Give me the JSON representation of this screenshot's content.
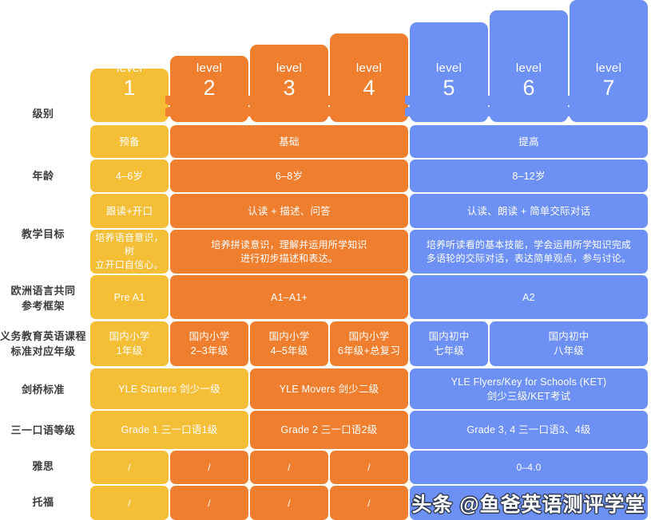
{
  "colors": {
    "yellow": "#F5BE37",
    "orange": "#EF7F2F",
    "blue": "#6C90F4",
    "label_text": "#3c3c3c",
    "cell_text": "#ffffff",
    "background": "#ffffff"
  },
  "levels": [
    {
      "word": "level",
      "num": "1",
      "color": "yellow"
    },
    {
      "word": "level",
      "num": "2",
      "color": "orange"
    },
    {
      "word": "level",
      "num": "3",
      "color": "orange"
    },
    {
      "word": "level",
      "num": "4",
      "color": "orange"
    },
    {
      "word": "level",
      "num": "5",
      "color": "blue"
    },
    {
      "word": "level",
      "num": "6",
      "color": "blue"
    },
    {
      "word": "level",
      "num": "7",
      "color": "blue"
    }
  ],
  "row_labels": [
    "级别",
    "年龄",
    "教学目标",
    "欧洲语言共同\n参考框架",
    "义务教育英语课程\n标准对应年级",
    "剑桥标准",
    "三一口语等级",
    "雅思",
    "托福"
  ],
  "row_label_lines": {
    "ji_bie": "级别",
    "nian_ling": "年龄",
    "jiao_xue_mu_biao": "教学目标",
    "ou_zhou_1": "欧洲语言共同",
    "ou_zhou_2": "参考框架",
    "yi_wu_1": "义务教育英语课程",
    "yi_wu_2": "标准对应年级",
    "jian_qiao": "剑桥标准",
    "san_yi": "三一口语等级",
    "ya_si": "雅思",
    "tuo_fu": "托福"
  },
  "rows": {
    "stage": [
      {
        "text": "预备",
        "color": "yellow"
      },
      {
        "text": "基础",
        "color": "orange"
      },
      {
        "text": "提高",
        "color": "blue"
      }
    ],
    "age": [
      {
        "text": "4–6岁",
        "color": "yellow"
      },
      {
        "text": "6–8岁",
        "color": "orange"
      },
      {
        "text": "8–12岁",
        "color": "blue"
      }
    ],
    "goal_short": [
      {
        "text": "跟读+开口",
        "color": "yellow"
      },
      {
        "text": "认读 + 描述、问答",
        "color": "orange"
      },
      {
        "text": "认读、朗读 + 简单交际对话",
        "color": "blue"
      }
    ],
    "goal_long": [
      {
        "line1": "培养语音意识，树",
        "line2": "立开口自信心。",
        "color": "yellow"
      },
      {
        "line1": "培养拼读意识，理解并运用所学知识",
        "line2": "进行初步描述和表达。",
        "color": "orange"
      },
      {
        "line1": "培养听读看的基本技能，学会运用所学知识完成",
        "line2": "多语轮的交际对话，表达简单观点，参与讨论。",
        "color": "blue"
      }
    ],
    "cefr": [
      {
        "text": "Pre A1",
        "color": "yellow"
      },
      {
        "text": "A1–A1+",
        "color": "orange"
      },
      {
        "text": "A2",
        "color": "blue"
      }
    ],
    "grade": [
      {
        "line1": "国内小学",
        "line2": "1年级",
        "color": "yellow"
      },
      {
        "line1": "国内小学",
        "line2": "2–3年级",
        "color": "orange"
      },
      {
        "line1": "国内小学",
        "line2": "4–5年级",
        "color": "orange"
      },
      {
        "line1": "国内小学",
        "line2": "6年级+总复习",
        "color": "orange"
      },
      {
        "line1": "国内初中",
        "line2": "七年级",
        "color": "blue"
      },
      {
        "line1": "国内初中",
        "line2": "八年级",
        "color": "blue"
      }
    ],
    "cambridge": [
      {
        "line1": "YLE Starters 剑少一级",
        "line2": "",
        "color": "yellow"
      },
      {
        "line1": "YLE Movers 剑少二级",
        "line2": "",
        "color": "orange"
      },
      {
        "line1": "YLE Flyers/Key for Schools (KET)",
        "line2": "剑少三级/KET考试",
        "color": "blue"
      }
    ],
    "trinity": [
      {
        "text": "Grade 1 三一口语1级",
        "color": "yellow"
      },
      {
        "text": "Grade 2 三一口语2级",
        "color": "orange"
      },
      {
        "text": "Grade 3, 4 三一口语3、4级",
        "color": "blue"
      }
    ],
    "ielts": [
      {
        "text": "/",
        "color": "yellow"
      },
      {
        "text": "/",
        "color": "orange"
      },
      {
        "text": "/",
        "color": "orange"
      },
      {
        "text": "/",
        "color": "orange"
      },
      {
        "text": "0–4.0",
        "color": "blue"
      }
    ],
    "toefl": [
      {
        "text": "/",
        "color": "yellow"
      },
      {
        "text": "/",
        "color": "orange"
      },
      {
        "text": "/",
        "color": "orange"
      },
      {
        "text": "/",
        "color": "orange"
      },
      {
        "text": "",
        "color": "blue"
      }
    ]
  },
  "watermark": {
    "text": "头条 @鱼爸英语测评学堂"
  }
}
